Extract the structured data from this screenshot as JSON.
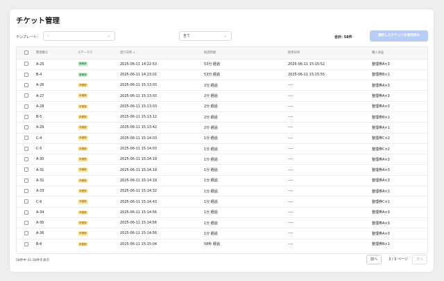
{
  "title": "チケット管理",
  "filters": {
    "template_label": "テンプレート:",
    "template_value": "-",
    "status_value": "全て",
    "total_text": "合計: 58件",
    "bulk_button": "選択したチケットを使用済み"
  },
  "table": {
    "headers": [
      "整理番号",
      "ステータス",
      "発行日時",
      "経過時間",
      "使用日時",
      "購入商品"
    ],
    "rows": [
      {
        "no": "A-25",
        "status": "使用済",
        "issued": "2025-06-11 14:22:53",
        "elapsed": "53分 経過",
        "used": "2025-06-11 15:15:52",
        "item": "整理券A×3"
      },
      {
        "no": "B-4",
        "status": "使用済",
        "issued": "2025-06-11 14:23:01",
        "elapsed": "53分 経過",
        "used": "2025-06-11 15:15:55",
        "item": "整理券B×1"
      },
      {
        "no": "A-26",
        "status": "未使用",
        "issued": "2025-06-11 15:13:03",
        "elapsed": "2分 経過",
        "used": "----",
        "item": "整理券A×3"
      },
      {
        "no": "A-27",
        "status": "未使用",
        "issued": "2025-06-11 15:13:03",
        "elapsed": "2分 経過",
        "used": "----",
        "item": "整理券A×3"
      },
      {
        "no": "A-28",
        "status": "未使用",
        "issued": "2025-06-11 15:13:03",
        "elapsed": "2分 経過",
        "used": "----",
        "item": "整理券A×3"
      },
      {
        "no": "B-5",
        "status": "未使用",
        "issued": "2025-06-11 15:13:12",
        "elapsed": "2分 経過",
        "used": "----",
        "item": "整理券B×1"
      },
      {
        "no": "A-29",
        "status": "未使用",
        "issued": "2025-06-11 15:13:42",
        "elapsed": "2分 経過",
        "used": "----",
        "item": "整理券A×1"
      },
      {
        "no": "C-4",
        "status": "未使用",
        "issued": "2025-06-11 15:14:03",
        "elapsed": "1分 経過",
        "used": "----",
        "item": "整理券C×2"
      },
      {
        "no": "C-5",
        "status": "未使用",
        "issued": "2025-06-11 15:14:03",
        "elapsed": "1分 経過",
        "used": "----",
        "item": "整理券C×2"
      },
      {
        "no": "A-30",
        "status": "未使用",
        "issued": "2025-06-11 15:14:19",
        "elapsed": "1分 経過",
        "used": "----",
        "item": "整理券A×3"
      },
      {
        "no": "A-31",
        "status": "未使用",
        "issued": "2025-06-11 15:14:19",
        "elapsed": "1分 経過",
        "used": "----",
        "item": "整理券A×3"
      },
      {
        "no": "A-32",
        "status": "未使用",
        "issued": "2025-06-11 15:14:19",
        "elapsed": "1分 経過",
        "used": "----",
        "item": "整理券A×3"
      },
      {
        "no": "A-33",
        "status": "未使用",
        "issued": "2025-06-11 15:14:32",
        "elapsed": "1分 経過",
        "used": "----",
        "item": "整理券A×1"
      },
      {
        "no": "C-6",
        "status": "未使用",
        "issued": "2025-06-11 15:14:43",
        "elapsed": "1分 経過",
        "used": "----",
        "item": "整理券C×1"
      },
      {
        "no": "A-34",
        "status": "未使用",
        "issued": "2025-06-11 15:14:56",
        "elapsed": "1分 経過",
        "used": "----",
        "item": "整理券A×3"
      },
      {
        "no": "A-35",
        "status": "未使用",
        "issued": "2025-06-11 15:14:56",
        "elapsed": "1分 経過",
        "used": "----",
        "item": "整理券A×3"
      },
      {
        "no": "A-36",
        "status": "未使用",
        "issued": "2025-06-11 15:14:56",
        "elapsed": "1分 経過",
        "used": "----",
        "item": "整理券A×3"
      },
      {
        "no": "B-6",
        "status": "未使用",
        "issued": "2025-06-11 15:15:04",
        "elapsed": "58秒 経過",
        "used": "----",
        "item": "整理券B×1"
      }
    ]
  },
  "status_colors": {
    "使用済": {
      "bg": "#d7f0d9",
      "fg": "#2f8a3b"
    },
    "未使用": {
      "bg": "#fbeab3",
      "fg": "#b07a10"
    }
  },
  "footer": {
    "info": "58件中 41-58件を表示",
    "prev": "前へ",
    "page": "3 / 3 ページ",
    "next": "次へ"
  }
}
